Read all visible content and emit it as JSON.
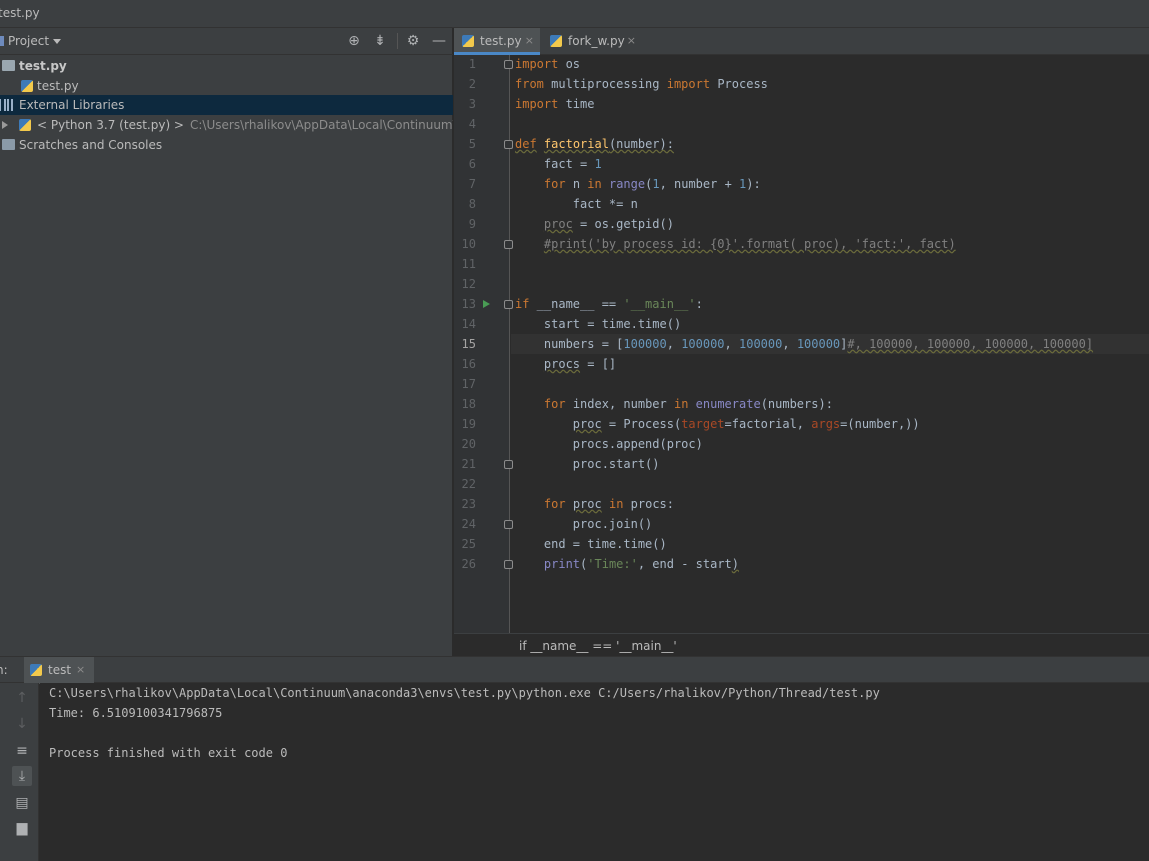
{
  "window": {
    "title": "test.py"
  },
  "project": {
    "title": "Project",
    "icons": [
      "locate-icon",
      "collapse-icon",
      "gear-icon",
      "hide-icon"
    ],
    "tree": [
      {
        "label": "test.py",
        "bold": true
      },
      {
        "label": "test.py"
      },
      {
        "label": "External Libraries",
        "selected": true
      },
      {
        "label": "< Python 3.7 (test.py) >",
        "path": "C:\\Users\\rhalikov\\AppData\\Local\\Continuum\\anaconda"
      },
      {
        "label": "Scratches and Consoles"
      }
    ]
  },
  "tabs": [
    {
      "label": "test.py",
      "close": "×",
      "active": true
    },
    {
      "label": "fork_w.py",
      "close": "×",
      "active": false
    }
  ],
  "editor": {
    "current_line": 15,
    "line_numbers": [
      "1",
      "2",
      "3",
      "4",
      "5",
      "6",
      "7",
      "8",
      "9",
      "10",
      "11",
      "12",
      "13",
      "14",
      "15",
      "16",
      "17",
      "18",
      "19",
      "20",
      "21",
      "22",
      "23",
      "24",
      "25",
      "26"
    ]
  },
  "breadcrumb": "if __name__ == '__main__'",
  "run": {
    "label": "n:",
    "tab_label": "test",
    "tab_close": "×",
    "toolbar_icons": [
      "up-arrow-icon",
      "down-arrow-icon",
      "soft-wrap-icon",
      "scroll-to-end-icon",
      "print-icon",
      "trash-icon"
    ],
    "console": [
      "C:\\Users\\rhalikov\\AppData\\Local\\Continuum\\anaconda3\\envs\\test.py\\python.exe C:/Users/rhalikov/Python/Thread/test.py",
      "Time: 6.5109100341796875",
      "",
      "Process finished with exit code 0"
    ]
  }
}
